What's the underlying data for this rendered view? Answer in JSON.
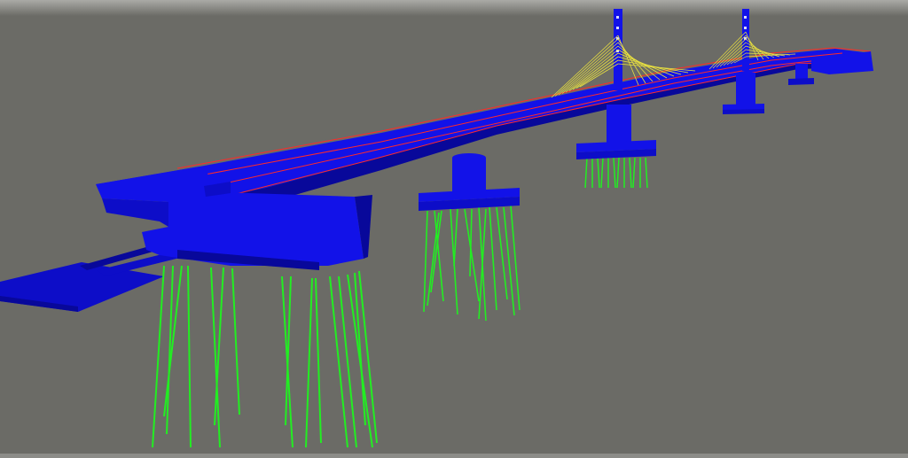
{
  "viewer": {
    "background": "#6b6b66",
    "sky_band": "#aaaaa6",
    "colors": {
      "structure": "#1212e8",
      "structure_dark": "#08089a",
      "structure_mid": "#0d0dc8",
      "lane_lines": "#ff2a2a",
      "piles": "#22ee22",
      "cables": "#e8e040"
    },
    "elements": [
      "bridge-deck",
      "pier",
      "pile-cap",
      "pile",
      "pylon",
      "stay-cable",
      "abutment",
      "approach-slab"
    ]
  }
}
